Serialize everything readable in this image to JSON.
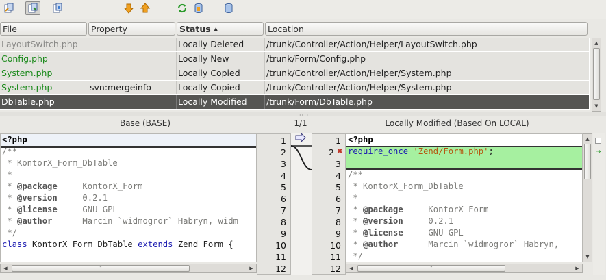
{
  "toolbar": {
    "buttons": [
      {
        "name": "show-all-changes-icon",
        "active": false
      },
      {
        "name": "show-local-changes-icon",
        "active": true
      },
      {
        "name": "show-remote-changes-icon",
        "active": false
      },
      {
        "name": "next-difference-icon",
        "active": false
      },
      {
        "name": "previous-difference-icon",
        "active": false
      },
      {
        "name": "refresh-icon",
        "active": false
      },
      {
        "name": "commit-icon",
        "active": false
      },
      {
        "name": "update-icon",
        "active": false
      }
    ]
  },
  "table": {
    "headers": {
      "file": "File",
      "property": "Property",
      "status": "Status",
      "sort_marker": "▲",
      "location": "Location"
    },
    "rows": [
      {
        "file": "LayoutSwitch.php",
        "property": "",
        "status": "Locally Deleted",
        "location": "/trunk/Controller/Action/Helper/LayoutSwitch.php",
        "color": "#8a8a88"
      },
      {
        "file": "Config.php",
        "property": "",
        "status": "Locally New",
        "location": "/trunk/Form/Config.php",
        "color": "#1c8a1c"
      },
      {
        "file": "System.php",
        "property": "",
        "status": "Locally Copied",
        "location": "/trunk/Controller/Action/Helper/System.php",
        "color": "#1c8a1c"
      },
      {
        "file": "System.php",
        "property": "svn:mergeinfo",
        "status": "Locally Copied",
        "location": "/trunk/Controller/Action/Helper/System.php",
        "color": "#1c8a1c"
      },
      {
        "file": "DbTable.php",
        "property": "",
        "status": "Locally Modified",
        "location": "/trunk/Form/DbTable.php",
        "color": "#ffffff"
      }
    ]
  },
  "diff": {
    "counter": "1/1",
    "base_title": "Base (BASE)",
    "local_title": "Locally Modified (Based On LOCAL)",
    "base_lines": [
      "<?php",
      "/**",
      " * KontorX_Form_DbTable",
      " *",
      " * @package     KontorX_Form",
      " * @version     0.2.1",
      " * @license     GNU GPL",
      " * @author      Marcin `widmogror` Habryn, widm",
      " */",
      "class KontorX_Form_DbTable extends Zend_Form {"
    ],
    "local_lines": [
      "<?php",
      "require_once 'Zend/Form.php';",
      "",
      "/**",
      " * KontorX_Form_DbTable",
      " *",
      " * @package     KontorX_Form",
      " * @version     0.2.1",
      " * @license     GNU GPL",
      " * @author      Marcin `widmogror` Habryn,",
      " */"
    ],
    "base_line_numbers": [
      "1",
      "2",
      "3",
      "4",
      "5",
      "6",
      "7",
      "8",
      "9",
      "10",
      "11",
      "12"
    ],
    "local_line_numbers": [
      "1",
      "2",
      "3",
      "4",
      "5",
      "6",
      "7",
      "8",
      "9",
      "10",
      "11",
      "12"
    ],
    "added_color": "#a6f0a0"
  }
}
